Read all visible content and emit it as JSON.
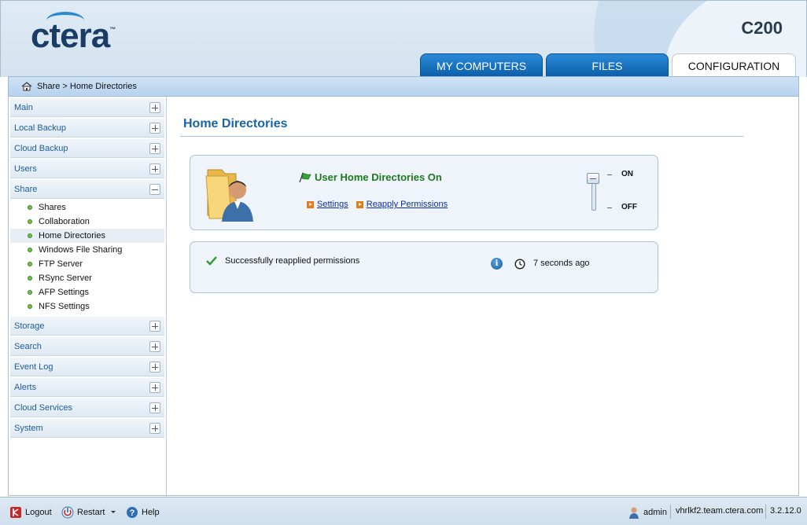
{
  "brand": {
    "logo_text": "ctera",
    "trademark": "™",
    "model": "C200"
  },
  "tabs": [
    {
      "label": "MY COMPUTERS",
      "active": false
    },
    {
      "label": "FILES",
      "active": false
    },
    {
      "label": "CONFIGURATION",
      "active": true
    }
  ],
  "breadcrumb": {
    "text": "Share > Home Directories"
  },
  "sidebar": {
    "sections": [
      {
        "label": "Main",
        "expanded": false
      },
      {
        "label": "Local Backup",
        "expanded": false
      },
      {
        "label": "Cloud Backup",
        "expanded": false
      },
      {
        "label": "Users",
        "expanded": false
      },
      {
        "label": "Share",
        "expanded": true,
        "items": [
          "Shares",
          "Collaboration",
          "Home Directories",
          "Windows File Sharing",
          "FTP Server",
          "RSync Server",
          "AFP Settings",
          "NFS Settings"
        ],
        "active_item": "Home Directories"
      },
      {
        "label": "Storage",
        "expanded": false
      },
      {
        "label": "Search",
        "expanded": false
      },
      {
        "label": "Event Log",
        "expanded": false
      },
      {
        "label": "Alerts",
        "expanded": false
      },
      {
        "label": "Cloud Services",
        "expanded": false
      },
      {
        "label": "System",
        "expanded": false
      }
    ]
  },
  "main": {
    "title": "Home Directories",
    "status": "User Home Directories On",
    "links": {
      "settings": "Settings",
      "reapply": "Reapply Permissions"
    },
    "toggle": {
      "on_label": "ON",
      "off_label": "OFF",
      "state": "ON"
    },
    "message": "Successfully reapplied permissions",
    "info_glyph": "i",
    "time_ago": "7 seconds ago"
  },
  "footer": {
    "logout": "Logout",
    "restart": "Restart",
    "help": "Help",
    "user": "admin",
    "host": "vhrlkf2.team.ctera.com",
    "version": "3.2.12.0"
  },
  "colors": {
    "accent": "#1a64a6",
    "tab_blue": "#0b5ea8",
    "status_green": "#1f7a1f",
    "link_blue": "#0a2fa8"
  }
}
